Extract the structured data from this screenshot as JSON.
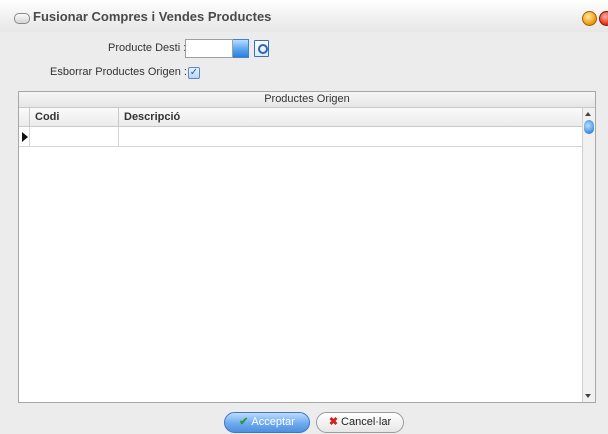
{
  "window": {
    "title": "Fusionar Compres i Vendes Productes"
  },
  "form": {
    "dest_label": "Producte Desti :",
    "dest_value": "",
    "delete_label": "Esborrar Productes Origen :",
    "delete_checked": true
  },
  "grid": {
    "title": "Productes Origen",
    "columns": [
      "Codi",
      "Descripció"
    ],
    "rows": [
      {
        "codi": "",
        "descripcio": ""
      }
    ]
  },
  "buttons": {
    "accept": "Acceptar",
    "cancel": "Cancel·lar"
  },
  "icons": {
    "accept": "check-icon",
    "cancel": "x-icon",
    "lookup": "lookup-icon",
    "dropdown": "dropdown-arrow-icon"
  },
  "colors": {
    "accent": "#4d8fe0",
    "close": "#e53b20",
    "minimize": "#f1a21a"
  }
}
